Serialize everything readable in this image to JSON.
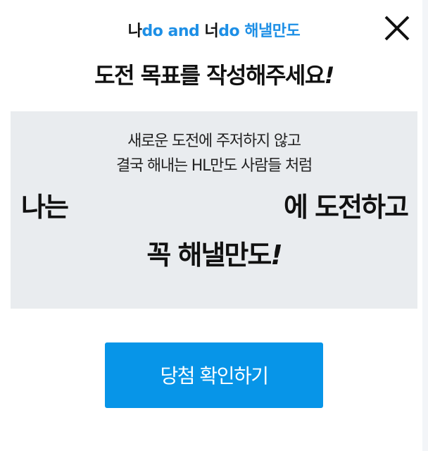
{
  "header": {
    "brand": {
      "part1": "나",
      "part2": "do and ",
      "part3": "너",
      "part4": "do 해낼만도"
    },
    "close_icon": "close-icon"
  },
  "headline": {
    "text": "도전 목표를 작성해주세요",
    "exclamation": "!"
  },
  "panel": {
    "subtitle_line1": "새로운 도전에 주저하지 않고",
    "subtitle_line2": "결국 해내는 HL만도 사람들 처럼",
    "prefix": "나는",
    "goal_input": {
      "value": "",
      "placeholder": ""
    },
    "suffix": "에 도전하고",
    "ending": "꼭 해낼만도",
    "ending_exclamation": "!"
  },
  "actions": {
    "confirm_label": "당첨 확인하기"
  },
  "colors": {
    "brand_blue": "#1d8fe6",
    "button_blue": "#0795e8",
    "panel_bg": "#e9ecef",
    "text_dark": "#111111"
  }
}
